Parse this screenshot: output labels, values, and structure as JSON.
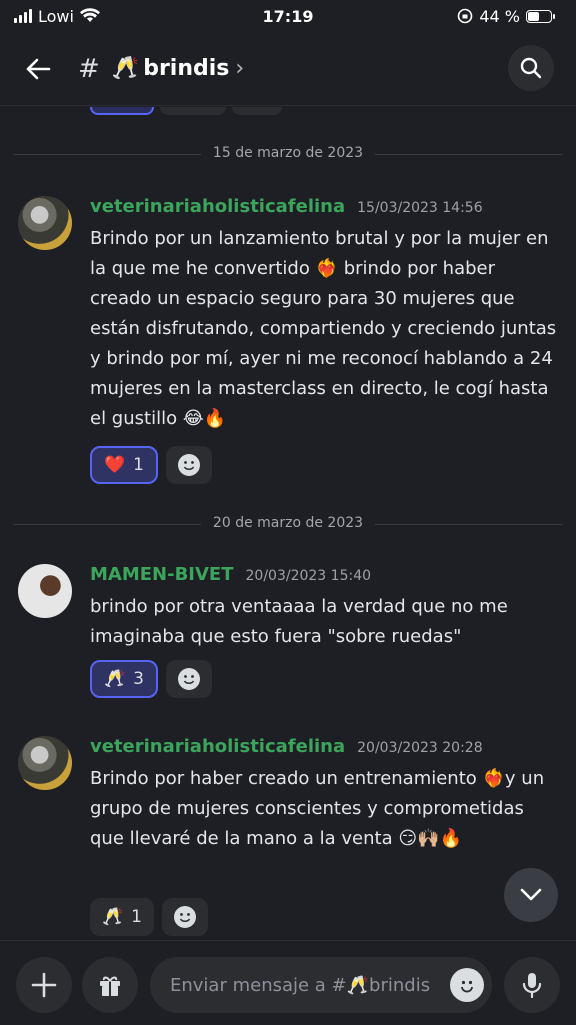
{
  "status_bar": {
    "carrier": "Lowi",
    "time": "17:19",
    "battery": "44 %",
    "battery_level": 0.44
  },
  "header": {
    "channel_hash": "#",
    "channel_emoji": "🥂",
    "channel_name": "brindis",
    "chevron": "›"
  },
  "dividers": [
    "15 de marzo de 2023",
    "20 de marzo de 2023"
  ],
  "messages": [
    {
      "author": "veterinariaholisticafelina",
      "timestamp": "15/03/2023 14:56",
      "text": "Brindo por un lanzamiento brutal y por la mujer en la que me he convertido ❤️‍🔥 brindo por haber creado un espacio seguro para 30 mujeres que están disfrutando, compartiendo y creciendo juntas y brindo por mí, ayer ni me reconocí hablando a 24 mujeres en la masterclass en directo, le cogí hasta el gustillo 😂🔥",
      "reaction": {
        "emoji": "❤️",
        "count": "1"
      }
    },
    {
      "author": "MAMEN-BIVET",
      "timestamp": "20/03/2023 15:40",
      "text": "brindo por otra ventaaaa la verdad que no me imaginaba que esto fuera \"sobre ruedas\"",
      "reaction": {
        "emoji": "🥂",
        "count": "3"
      }
    },
    {
      "author": "veterinariaholisticafelina",
      "timestamp": "20/03/2023 20:28",
      "text": "Brindo por haber creado un entrenamiento ❤️‍🔥y un grupo de mujeres conscientes y comprometidas que llevaré de la mano a la venta 😏🙌🏼🔥",
      "reaction": {
        "emoji": "🥂",
        "count": "1"
      }
    }
  ],
  "composer": {
    "placeholder": "Enviar mensaje a #🥂brindis"
  },
  "icons": [
    "back-arrow-icon",
    "search-icon",
    "add-reaction-icon",
    "chevron-down-icon",
    "plus-icon",
    "gift-icon",
    "emoji-icon",
    "microphone-icon"
  ]
}
